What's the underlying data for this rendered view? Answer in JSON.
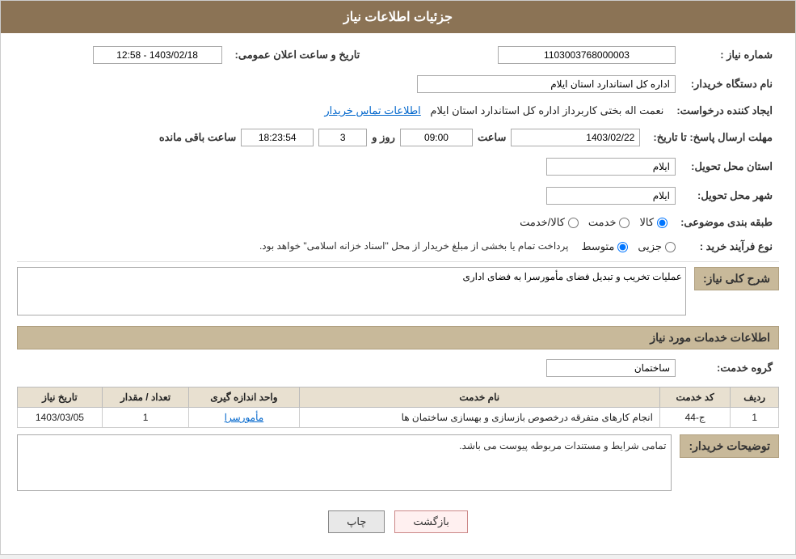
{
  "header": {
    "title": "جزئیات اطلاعات نیاز"
  },
  "labels": {
    "need_number": "شماره نیاز :",
    "buyer_org": "نام دستگاه خریدار:",
    "creator": "ایجاد کننده درخواست:",
    "send_deadline": "مهلت ارسال پاسخ: تا تاریخ:",
    "province": "استان محل تحویل:",
    "city": "شهر محل تحویل:",
    "category": "طبقه بندی موضوعی:",
    "purchase_type": "نوع فرآیند خرید :",
    "general_desc": "شرح کلی نیاز:",
    "services_section": "اطلاعات خدمات مورد نیاز",
    "service_group": "گروه خدمت:",
    "buyer_notes": "توضیحات خریدار:"
  },
  "values": {
    "need_number": "1103003768000003",
    "buyer_org": "اداره کل استاندارد استان ایلام",
    "creator": "نعمت اله بختی کاربرداز اداره کل استاندارد استان ایلام",
    "contact_link": "اطلاعات تماس خریدار",
    "announce_label": "تاریخ و ساعت اعلان عمومی:",
    "announce_value": "1403/02/18 - 12:58",
    "deadline_date": "1403/02/22",
    "deadline_time_label": "ساعت",
    "deadline_time": "09:00",
    "days_label": "روز و",
    "days_count": "3",
    "remaining_label": "ساعت باقی مانده",
    "remaining_time": "18:23:54",
    "province_value": "ایلام",
    "city_value": "ایلام",
    "category_options": [
      "کالا",
      "خدمت",
      "کالا/خدمت"
    ],
    "category_selected": "کالا",
    "purchase_options": [
      "جزیی",
      "متوسط"
    ],
    "purchase_selected": "متوسط",
    "purchase_note": "پرداخت تمام یا بخشی از مبلغ خریدار از محل \"اسناد خزانه اسلامی\" خواهد بود.",
    "general_desc_value": "عملیات تخریب و تبدیل فضای مأمورسرا به فضای اداری",
    "service_group_value": "ساختمان",
    "table_headers": [
      "ردیف",
      "کد خدمت",
      "نام خدمت",
      "واحد اندازه گیری",
      "تعداد / مقدار",
      "تاریخ نیاز"
    ],
    "table_rows": [
      {
        "row": "1",
        "code": "ج-44",
        "name": "انجام کارهای متفرقه درخصوص بازسازی و بهسازی ساختمان ها",
        "unit": "مأمورسرا",
        "qty": "1",
        "date": "1403/03/05"
      }
    ],
    "buyer_notes_value": "تمامی شرایط و مستندات مربوطه پیوست می باشد.",
    "btn_print": "چاپ",
    "btn_back": "بازگشت"
  }
}
